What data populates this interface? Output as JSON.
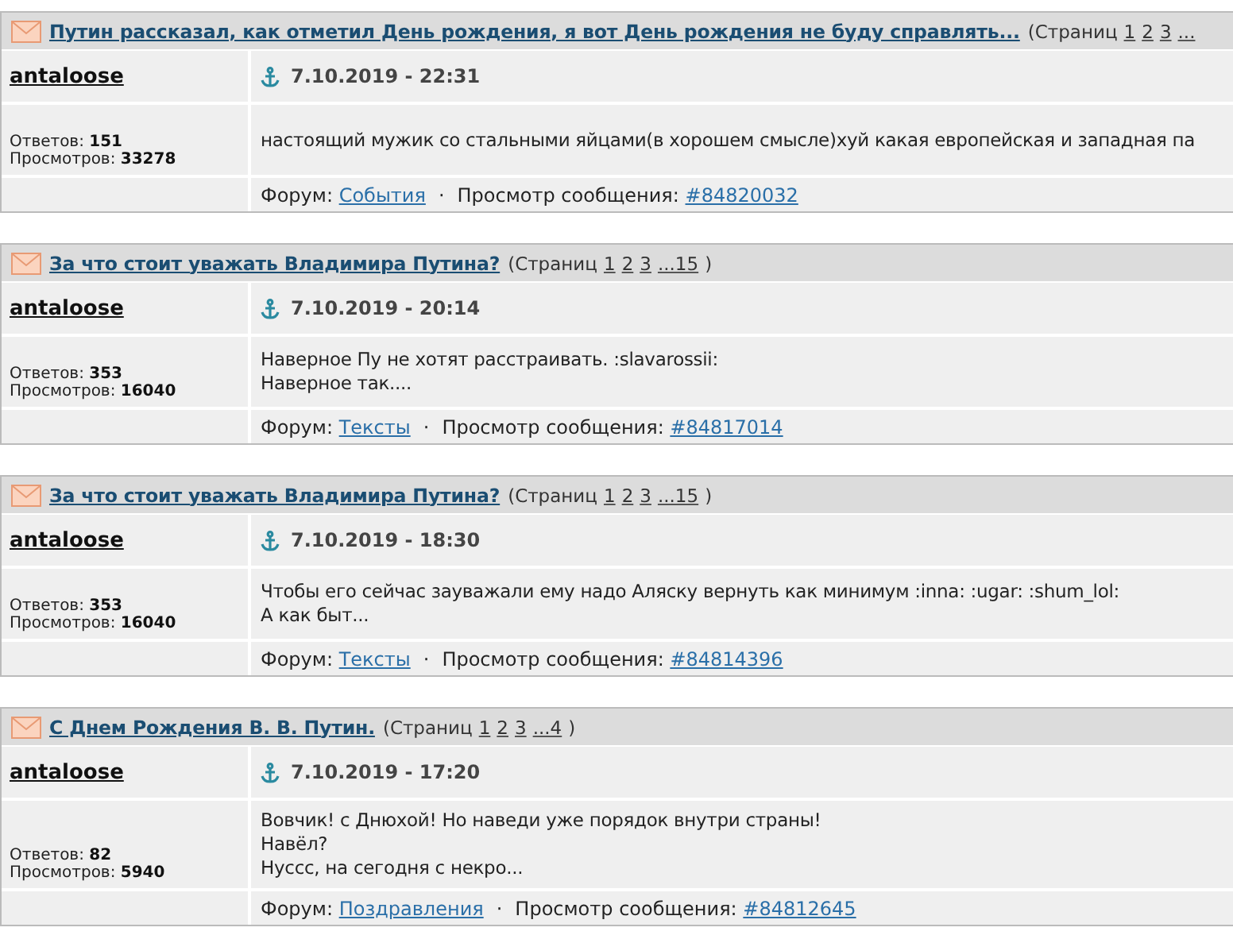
{
  "posts": [
    {
      "topic": "Путин рассказал, как отметил День рождения, я вот День рождения не буду справлять...",
      "pages_label": "(Страниц",
      "pages": [
        "1",
        "2",
        "3",
        "..."
      ],
      "author": "antaloose",
      "replies_label": "Ответов:",
      "replies": "151",
      "views_label": "Просмотров:",
      "views": "33278",
      "date": "7.10.2019 - 22:31",
      "body": [
        "настоящий мужик со стальными яйцами(в хорошем смысле)хуй какая европейская и западная па"
      ],
      "forum_label": "Форум:",
      "forum": "События",
      "separator": "·",
      "view_label": "Просмотр сообщения:",
      "post_link": "#84820032"
    },
    {
      "topic": "За что стоит уважать Владимира Путина?",
      "pages_label": "(Страниц",
      "pages": [
        "1",
        "2",
        "3",
        "...15"
      ],
      "pages_close": ")",
      "author": "antaloose",
      "replies_label": "Ответов:",
      "replies": "353",
      "views_label": "Просмотров:",
      "views": "16040",
      "date": "7.10.2019 - 20:14",
      "body": [
        "Наверное Пу не хотят расстраивать. :slavarossii:",
        "Наверное так...."
      ],
      "forum_label": "Форум:",
      "forum": "Тексты",
      "separator": "·",
      "view_label": "Просмотр сообщения:",
      "post_link": "#84817014"
    },
    {
      "topic": "За что стоит уважать Владимира Путина?",
      "pages_label": "(Страниц",
      "pages": [
        "1",
        "2",
        "3",
        "...15"
      ],
      "pages_close": ")",
      "author": "antaloose",
      "replies_label": "Ответов:",
      "replies": "353",
      "views_label": "Просмотров:",
      "views": "16040",
      "date": "7.10.2019 - 18:30",
      "body": [
        "Чтобы его сейчас зауважали ему надо Аляску вернуть как минимум :inna: :ugar: :shum_lol:",
        "А как быт..."
      ],
      "forum_label": "Форум:",
      "forum": "Тексты",
      "separator": "·",
      "view_label": "Просмотр сообщения:",
      "post_link": "#84814396"
    },
    {
      "topic": "С Днем Рождения В. В. Путин.",
      "pages_label": "(Страниц",
      "pages": [
        "1",
        "2",
        "3",
        "...4"
      ],
      "pages_close": ")",
      "author": "antaloose",
      "replies_label": "Ответов:",
      "replies": "82",
      "views_label": "Просмотров:",
      "views": "5940",
      "date": "7.10.2019 - 17:20",
      "body": [
        "Вовчик! с Днюхой! Но наведи уже порядок внутри страны!",
        "Навёл?",
        "Нуссс, на сегодня с некро..."
      ],
      "forum_label": "Форум:",
      "forum": "Поздравления",
      "separator": "·",
      "view_label": "Просмотр сообщения:",
      "post_link": "#84812645"
    }
  ]
}
